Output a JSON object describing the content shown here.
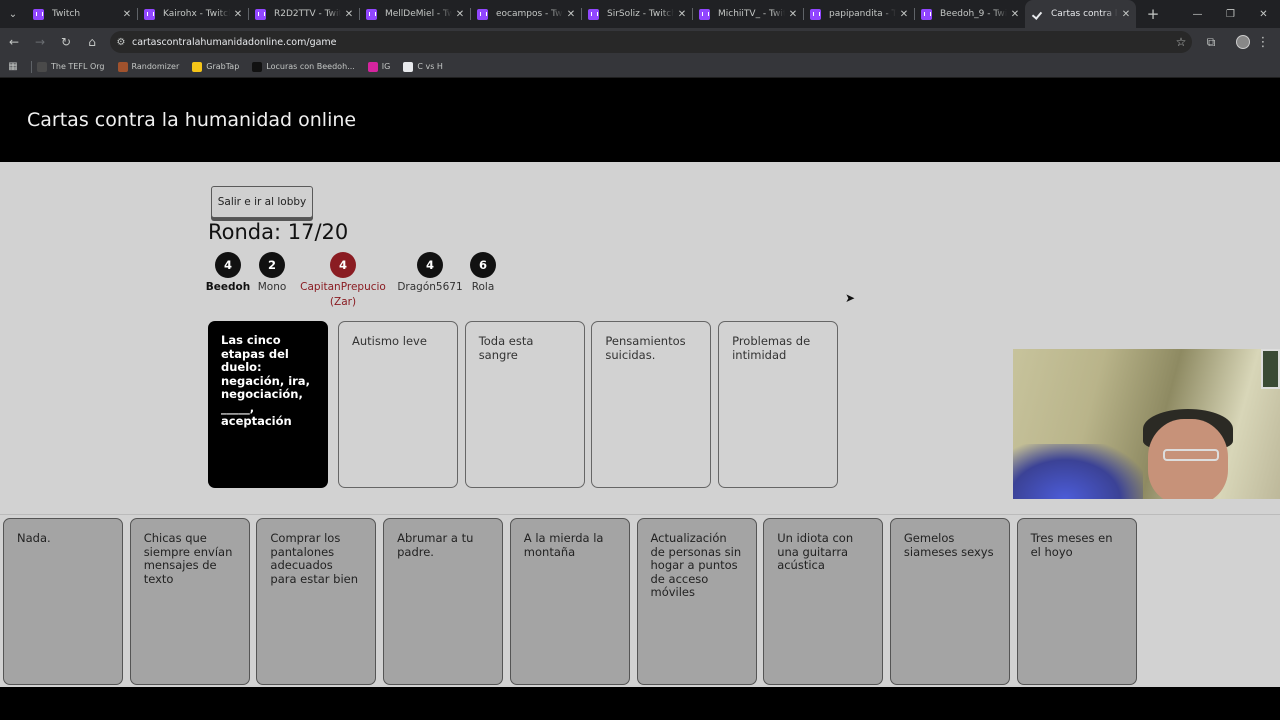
{
  "browser": {
    "tabs": [
      {
        "title": "Twitch",
        "icon": "twitch-icon",
        "active": false
      },
      {
        "title": "Kairohx - Twitch",
        "icon": "twitch-icon",
        "active": false
      },
      {
        "title": "R2D2TTV - Twitch",
        "icon": "twitch-icon",
        "active": false
      },
      {
        "title": "MellDeMiel - Twit",
        "icon": "twitch-icon",
        "active": false
      },
      {
        "title": "eocampos - Twitc",
        "icon": "twitch-icon",
        "active": false
      },
      {
        "title": "SirSoliz - Twitch",
        "icon": "twitch-icon",
        "active": false
      },
      {
        "title": "MichiiTV_ - Twitch",
        "icon": "twitch-icon",
        "active": false
      },
      {
        "title": "papipandita - Twi",
        "icon": "twitch-icon",
        "active": false
      },
      {
        "title": "Beedoh_9 - Twitc",
        "icon": "twitch-icon",
        "active": false
      },
      {
        "title": "Cartas contra la h",
        "icon": "check-icon",
        "active": true
      }
    ],
    "url": "cartascontralahumanidadonline.com/game",
    "bookmarks": [
      {
        "label": "The TEFL Org",
        "color": "#4a4a4a"
      },
      {
        "label": "Randomizer",
        "color": "#a0522d"
      },
      {
        "label": "GrabTap",
        "color": "#f5c518"
      },
      {
        "label": "Locuras con Beedoh...",
        "color": "#111111"
      },
      {
        "label": "IG",
        "color": "#d6249f"
      },
      {
        "label": "C vs H",
        "color": "#e8eaed"
      }
    ]
  },
  "site": {
    "title": "Cartas contra la humanidad online"
  },
  "game": {
    "lobby_button": "Salir e ir al lobby",
    "round_label": "Ronda: 17/20",
    "players": [
      {
        "name": "Beedoh",
        "score": "4",
        "me": true,
        "czar": false
      },
      {
        "name": "Mono",
        "score": "2",
        "me": false,
        "czar": false
      },
      {
        "name": "CapitanPrepucio (Zar)",
        "score": "4",
        "me": false,
        "czar": true
      },
      {
        "name": "Dragón5671",
        "score": "4",
        "me": false,
        "czar": false
      },
      {
        "name": "Rola",
        "score": "6",
        "me": false,
        "czar": false
      }
    ],
    "black_card": "Las cinco etapas del duelo: negación, ira, negociación, _____, aceptación",
    "played_cards": [
      "Autismo leve",
      "Toda esta sangre",
      "Pensamientos suicidas.",
      "Problemas de intimidad"
    ],
    "hand_cards": [
      "Nada.",
      "Chicas que siempre envían mensajes de texto",
      "Comprar los pantalones adecuados para estar bien",
      "Abrumar a tu padre.",
      "A la mierda la montaña",
      "Actualización de personas sin hogar a puntos de acceso móviles",
      "Un idiota con una guitarra acústica",
      "Gemelos siameses sexys",
      "Tres meses en el hoyo"
    ]
  },
  "colors": {
    "czar": "#8a1c22",
    "page_bg": "#d2d2d2",
    "hand_card_bg": "#a4a4a4"
  }
}
